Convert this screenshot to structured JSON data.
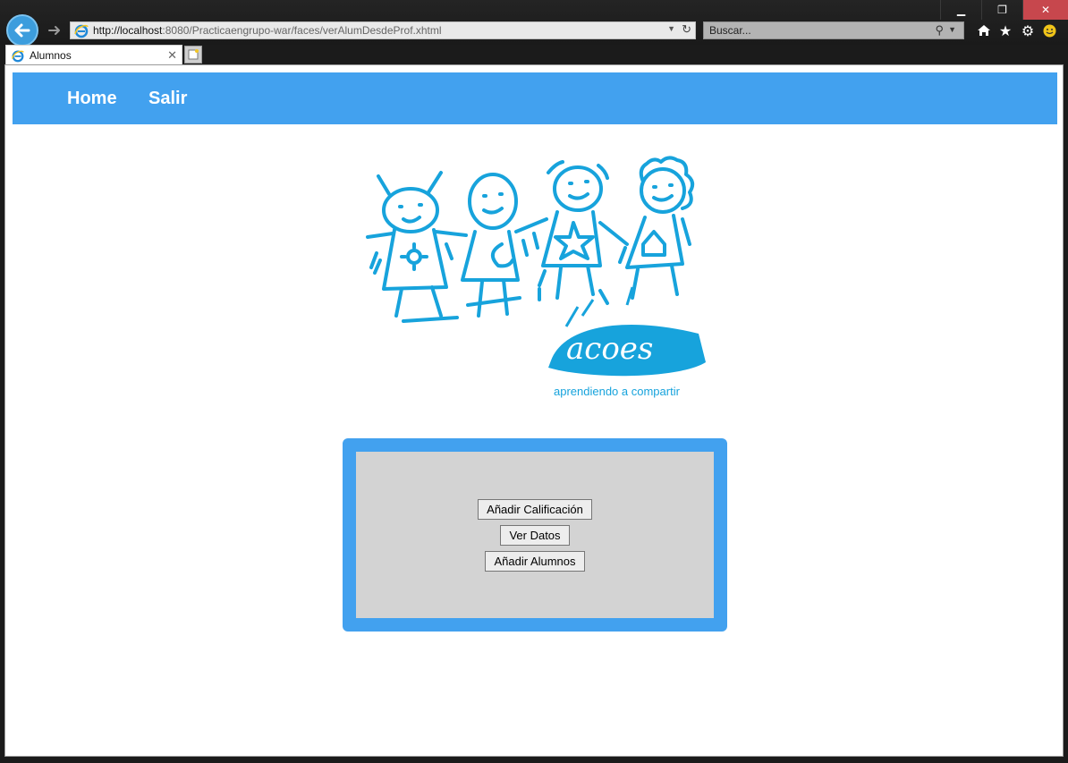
{
  "window": {
    "minimize": "▁",
    "maximize": "❐",
    "close": "✕"
  },
  "browser": {
    "url_host": "http://localhost",
    "url_rest": ":8080/Practicaengrupo-war/faces/verAlumDesdeProf.xhtml",
    "search_placeholder": "Buscar...",
    "tab_title": "Alumnos",
    "icons": [
      "back-arrow-icon",
      "forward-arrow-icon",
      "ie-logo-icon",
      "refresh-icon",
      "search-icon",
      "home-icon",
      "star-icon",
      "gear-icon",
      "smiley-icon",
      "new-tab-icon"
    ]
  },
  "nav": {
    "home": "Home",
    "salir": "Salir",
    "bar_color": "#42a1ef"
  },
  "logo": {
    "wordmark": "acoes",
    "caption": "aprendiendo a compartir",
    "color": "#17a3dc"
  },
  "panel": {
    "buttons": {
      "add_grade": "Añadir Calificación",
      "view_data": "Ver Datos",
      "add_students": "Añadir Alumnos"
    }
  }
}
